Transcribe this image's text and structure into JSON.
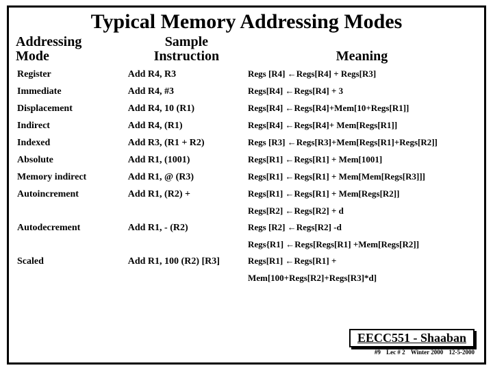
{
  "title": "Typical Memory Addressing Modes",
  "headers": {
    "mode": "Addressing\nMode",
    "instr": "Sample\nInstruction",
    "meaning": "Meaning"
  },
  "rows": [
    {
      "mode": "Register",
      "instr": "Add R4, R3",
      "meaning": "Regs [R4] ←Regs[R4] + Regs[R3]"
    },
    {
      "mode": "Immediate",
      "instr": "Add R4, #3",
      "meaning": "Regs[R4] ←Regs[R4] + 3"
    },
    {
      "mode": "Displacement",
      "instr": "Add R4, 10 (R1)",
      "meaning": "Regs[R4] ←Regs[R4]+Mem[10+Regs[R1]]"
    },
    {
      "mode": "Indirect",
      "instr": "Add R4, (R1)",
      "meaning": "Regs[R4] ←Regs[R4]+ Mem[Regs[R1]]"
    },
    {
      "mode": "Indexed",
      "instr": "Add R3, (R1 + R2)",
      "meaning": "Regs [R3] ←Regs[R3]+Mem[Regs[R1]+Regs[R2]]"
    },
    {
      "mode": "Absolute",
      "instr": "Add R1, (1001)",
      "meaning": "Regs[R1] ←Regs[R1] + Mem[1001]"
    },
    {
      "mode": "Memory indirect",
      "instr": "Add R1, @ (R3)",
      "meaning": "Regs[R1] ←Regs[R1] + Mem[Mem[Regs[R3]]]"
    },
    {
      "mode": "Autoincrement",
      "instr": "Add R1, (R2) +",
      "meaning": "Regs[R1] ←Regs[R1] +  Mem[Regs[R2]]"
    },
    {
      "mode": "",
      "instr": "",
      "meaning": "Regs[R2] ←Regs[R2] + d"
    },
    {
      "mode": "Autodecrement",
      "instr": "Add R1, - (R2)",
      "meaning": "Regs [R2] ←Regs[R2] -d"
    },
    {
      "mode": "",
      "instr": "",
      "meaning": "Regs{R1] ←Regs[Regs[R1] +Mem[Regs[R2]]"
    },
    {
      "mode": "Scaled",
      "instr": "Add R1, 100 (R2) [R3]",
      "meaning": "Regs[R1] ←Regs[R1] +"
    },
    {
      "mode": "",
      "instr": "",
      "meaning": "Mem[100+Regs[R2]+Regs[R3]*d]"
    }
  ],
  "footer": {
    "box": "EECC551 - Shaaban",
    "slide_no": "#9",
    "lec": "Lec # 2",
    "term": "Winter 2000",
    "date": "12-5-2000"
  }
}
